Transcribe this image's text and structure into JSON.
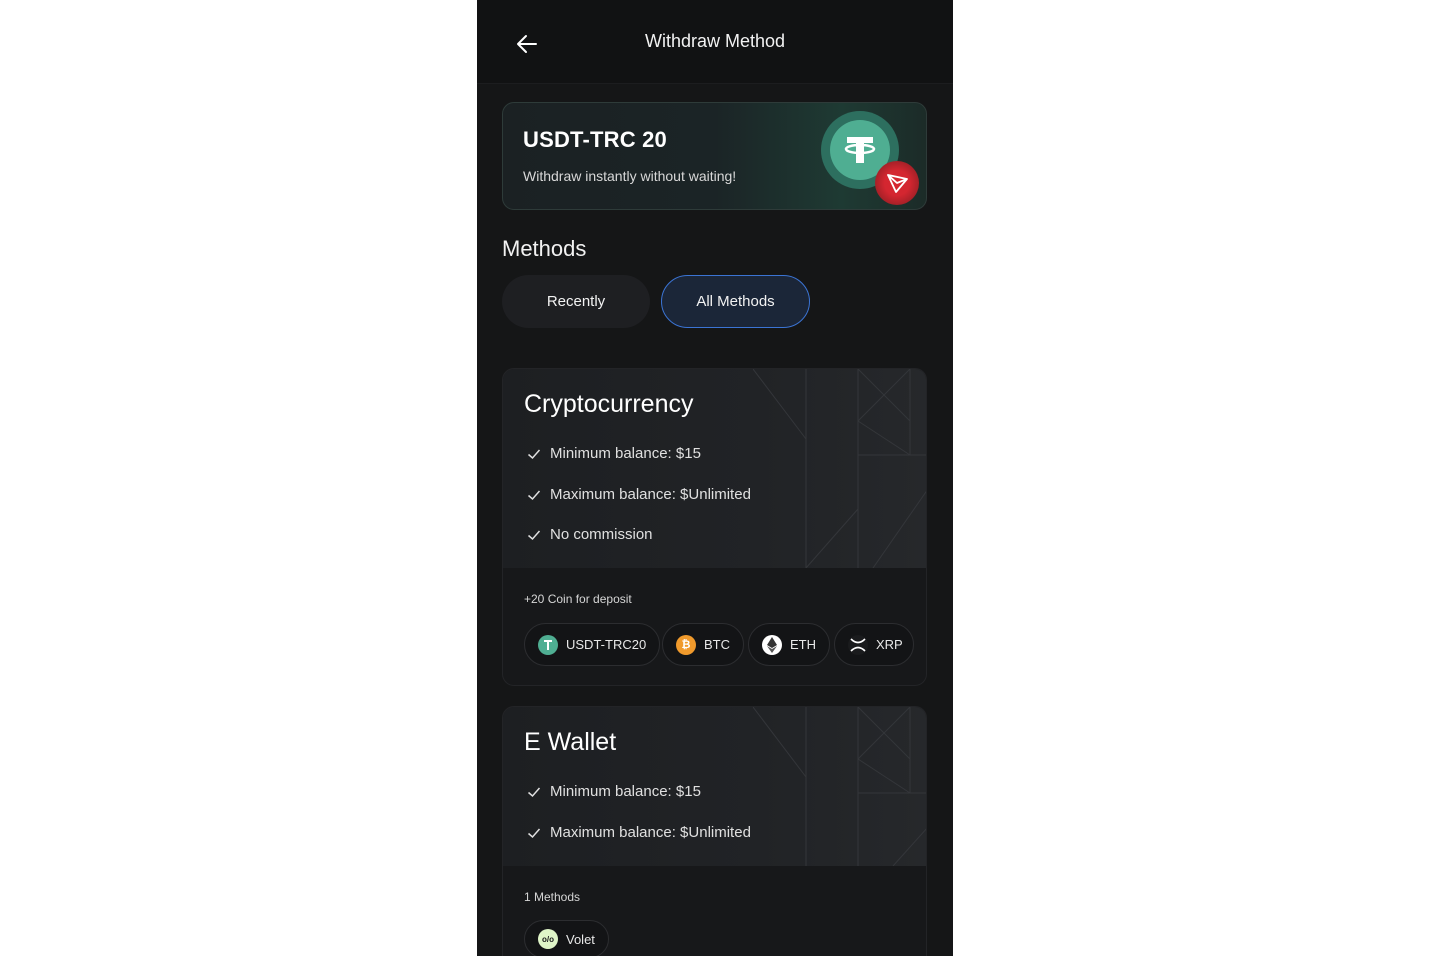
{
  "header": {
    "title": "Withdraw Method"
  },
  "promo": {
    "title": "USDT-TRC 20",
    "subtitle": "Withdraw instantly without waiting!"
  },
  "methods": {
    "title": "Methods",
    "tabs": [
      {
        "label": "Recently",
        "active": false
      },
      {
        "label": "All Methods",
        "active": true
      }
    ]
  },
  "cards": [
    {
      "title": "Cryptocurrency",
      "features": [
        "Minimum balance: $15",
        "Maximum balance: $Unlimited",
        "No commission"
      ],
      "subtitle": "+20 Coin for deposit",
      "chips": [
        {
          "label": "USDT-TRC20",
          "icon": "tether-icon",
          "color": "#4fae92"
        },
        {
          "label": "BTC",
          "icon": "bitcoin-icon",
          "color": "#f09a2c"
        },
        {
          "label": "ETH",
          "icon": "ethereum-icon",
          "color": "#ffffff"
        },
        {
          "label": "XRP",
          "icon": "xrp-icon",
          "color": "#1a1b1d"
        }
      ]
    },
    {
      "title": "E Wallet",
      "features": [
        "Minimum balance: $15",
        "Maximum balance: $Unlimited"
      ],
      "subtitle": "1 Methods",
      "chips": [
        {
          "label": "Volet",
          "icon": "volet-icon",
          "color": "#dff5c8"
        }
      ]
    }
  ],
  "colors": {
    "background": "#151617",
    "accent": "#3b74d4",
    "promo_green": "#4fae92",
    "tron_red": "#d42630"
  }
}
